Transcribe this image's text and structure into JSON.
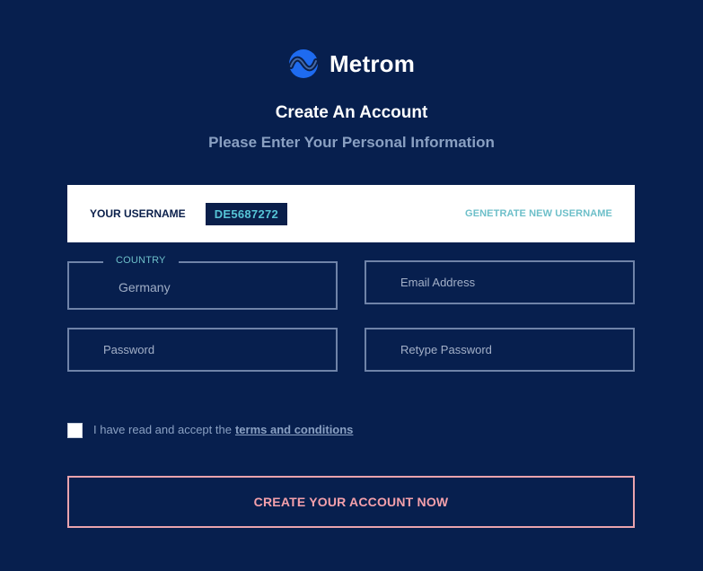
{
  "brand": {
    "name": "Metrom"
  },
  "header": {
    "title": "Create An Account",
    "subtitle": "Please Enter Your Personal Information"
  },
  "username": {
    "label": "YOUR USERNAME",
    "value": "DE5687272",
    "generate_label": "GENETRATE NEW USERNAME"
  },
  "form": {
    "country": {
      "legend": "COUNTRY",
      "value": "Germany"
    },
    "email": {
      "placeholder": "Email Address"
    },
    "password": {
      "placeholder": "Password"
    },
    "retype_password": {
      "placeholder": "Retype Password"
    }
  },
  "terms": {
    "text": "I have read and accept the",
    "link": "terms and conditions",
    "checked": false
  },
  "submit": {
    "label": "CREATE YOUR ACCOUNT NOW"
  },
  "colors": {
    "background": "#071f4e",
    "accent_teal": "#6dbfc9",
    "accent_pink": "#f4a0ab",
    "logo_blue": "#2f80ff"
  }
}
